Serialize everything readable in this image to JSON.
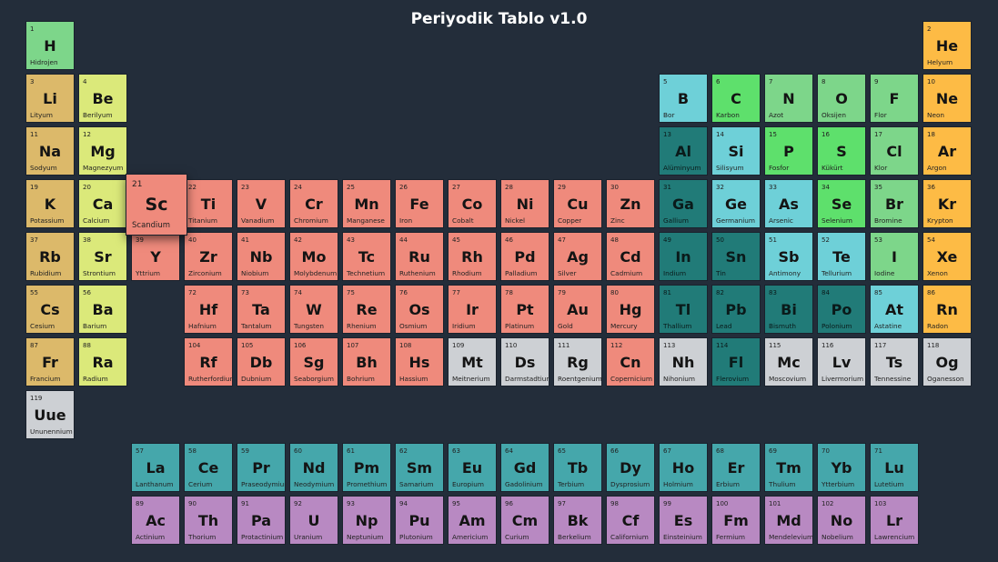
{
  "title": "Periyodik Tablo v1.0",
  "hovered_element": "Sc",
  "colors": {
    "hydrogen": "#7dd68a",
    "alkali": "#dcb96a",
    "alkaline": "#dbe97a",
    "transition": "#ef8a7c",
    "poor_metal": "#217b78",
    "metalloid": "#6ed0d8",
    "nonmetal": "#5ee06c",
    "halogen": "#7dd68a",
    "noble": "#fdbb45",
    "unknown": "#cdd0d4",
    "lanthanide": "#45a7ab",
    "actinide": "#b889c2"
  },
  "elements": [
    {
      "n": "1",
      "s": "H",
      "name": "Hidrojen",
      "c": "hydrogen"
    },
    {
      "n": "2",
      "s": "He",
      "name": "Helyum",
      "c": "noble"
    },
    {
      "n": "3",
      "s": "Li",
      "name": "Lityum",
      "c": "alkali"
    },
    {
      "n": "4",
      "s": "Be",
      "name": "Berilyum",
      "c": "alkaline"
    },
    {
      "n": "5",
      "s": "B",
      "name": "Bor",
      "c": "metalloid"
    },
    {
      "n": "6",
      "s": "C",
      "name": "Karbon",
      "c": "nonmetal"
    },
    {
      "n": "7",
      "s": "N",
      "name": "Azot",
      "c": "halogen"
    },
    {
      "n": "8",
      "s": "O",
      "name": "Oksijen",
      "c": "halogen"
    },
    {
      "n": "9",
      "s": "F",
      "name": "Flor",
      "c": "halogen"
    },
    {
      "n": "10",
      "s": "Ne",
      "name": "Neon",
      "c": "noble"
    },
    {
      "n": "11",
      "s": "Na",
      "name": "Sodyum",
      "c": "alkali"
    },
    {
      "n": "12",
      "s": "Mg",
      "name": "Magnezyum",
      "c": "alkaline"
    },
    {
      "n": "13",
      "s": "Al",
      "name": "Alüminyum",
      "c": "poor_metal"
    },
    {
      "n": "14",
      "s": "Si",
      "name": "Silisyum",
      "c": "metalloid"
    },
    {
      "n": "15",
      "s": "P",
      "name": "Fosfor",
      "c": "nonmetal"
    },
    {
      "n": "16",
      "s": "S",
      "name": "Kükürt",
      "c": "nonmetal"
    },
    {
      "n": "17",
      "s": "Cl",
      "name": "Klor",
      "c": "halogen"
    },
    {
      "n": "18",
      "s": "Ar",
      "name": "Argon",
      "c": "noble"
    },
    {
      "n": "19",
      "s": "K",
      "name": "Potassium",
      "c": "alkali"
    },
    {
      "n": "20",
      "s": "Ca",
      "name": "Calcium",
      "c": "alkaline"
    },
    {
      "n": "21",
      "s": "Sc",
      "name": "Scandium",
      "c": "transition"
    },
    {
      "n": "22",
      "s": "Ti",
      "name": "Titanium",
      "c": "transition"
    },
    {
      "n": "23",
      "s": "V",
      "name": "Vanadium",
      "c": "transition"
    },
    {
      "n": "24",
      "s": "Cr",
      "name": "Chromium",
      "c": "transition"
    },
    {
      "n": "25",
      "s": "Mn",
      "name": "Manganese",
      "c": "transition"
    },
    {
      "n": "26",
      "s": "Fe",
      "name": "Iron",
      "c": "transition"
    },
    {
      "n": "27",
      "s": "Co",
      "name": "Cobalt",
      "c": "transition"
    },
    {
      "n": "28",
      "s": "Ni",
      "name": "Nickel",
      "c": "transition"
    },
    {
      "n": "29",
      "s": "Cu",
      "name": "Copper",
      "c": "transition"
    },
    {
      "n": "30",
      "s": "Zn",
      "name": "Zinc",
      "c": "transition"
    },
    {
      "n": "31",
      "s": "Ga",
      "name": "Gallium",
      "c": "poor_metal"
    },
    {
      "n": "32",
      "s": "Ge",
      "name": "Germanium",
      "c": "metalloid"
    },
    {
      "n": "33",
      "s": "As",
      "name": "Arsenic",
      "c": "metalloid"
    },
    {
      "n": "34",
      "s": "Se",
      "name": "Selenium",
      "c": "nonmetal"
    },
    {
      "n": "35",
      "s": "Br",
      "name": "Bromine",
      "c": "halogen"
    },
    {
      "n": "36",
      "s": "Kr",
      "name": "Krypton",
      "c": "noble"
    },
    {
      "n": "37",
      "s": "Rb",
      "name": "Rubidium",
      "c": "alkali"
    },
    {
      "n": "38",
      "s": "Sr",
      "name": "Strontium",
      "c": "alkaline"
    },
    {
      "n": "39",
      "s": "Y",
      "name": "Yttrium",
      "c": "transition"
    },
    {
      "n": "40",
      "s": "Zr",
      "name": "Zirconium",
      "c": "transition"
    },
    {
      "n": "41",
      "s": "Nb",
      "name": "Niobium",
      "c": "transition"
    },
    {
      "n": "42",
      "s": "Mo",
      "name": "Molybdenum",
      "c": "transition"
    },
    {
      "n": "43",
      "s": "Tc",
      "name": "Technetium",
      "c": "transition"
    },
    {
      "n": "44",
      "s": "Ru",
      "name": "Ruthenium",
      "c": "transition"
    },
    {
      "n": "45",
      "s": "Rh",
      "name": "Rhodium",
      "c": "transition"
    },
    {
      "n": "46",
      "s": "Pd",
      "name": "Palladium",
      "c": "transition"
    },
    {
      "n": "47",
      "s": "Ag",
      "name": "Silver",
      "c": "transition"
    },
    {
      "n": "48",
      "s": "Cd",
      "name": "Cadmium",
      "c": "transition"
    },
    {
      "n": "49",
      "s": "In",
      "name": "Indium",
      "c": "poor_metal"
    },
    {
      "n": "50",
      "s": "Sn",
      "name": "Tin",
      "c": "poor_metal"
    },
    {
      "n": "51",
      "s": "Sb",
      "name": "Antimony",
      "c": "metalloid"
    },
    {
      "n": "52",
      "s": "Te",
      "name": "Tellurium",
      "c": "metalloid"
    },
    {
      "n": "53",
      "s": "I",
      "name": "Iodine",
      "c": "halogen"
    },
    {
      "n": "54",
      "s": "Xe",
      "name": "Xenon",
      "c": "noble"
    },
    {
      "n": "55",
      "s": "Cs",
      "name": "Cesium",
      "c": "alkali"
    },
    {
      "n": "56",
      "s": "Ba",
      "name": "Barium",
      "c": "alkaline"
    },
    {
      "n": "72",
      "s": "Hf",
      "name": "Hafnium",
      "c": "transition"
    },
    {
      "n": "73",
      "s": "Ta",
      "name": "Tantalum",
      "c": "transition"
    },
    {
      "n": "74",
      "s": "W",
      "name": "Tungsten",
      "c": "transition"
    },
    {
      "n": "75",
      "s": "Re",
      "name": "Rhenium",
      "c": "transition"
    },
    {
      "n": "76",
      "s": "Os",
      "name": "Osmium",
      "c": "transition"
    },
    {
      "n": "77",
      "s": "Ir",
      "name": "Iridium",
      "c": "transition"
    },
    {
      "n": "78",
      "s": "Pt",
      "name": "Platinum",
      "c": "transition"
    },
    {
      "n": "79",
      "s": "Au",
      "name": "Gold",
      "c": "transition"
    },
    {
      "n": "80",
      "s": "Hg",
      "name": "Mercury",
      "c": "transition"
    },
    {
      "n": "81",
      "s": "Tl",
      "name": "Thallium",
      "c": "poor_metal"
    },
    {
      "n": "82",
      "s": "Pb",
      "name": "Lead",
      "c": "poor_metal"
    },
    {
      "n": "83",
      "s": "Bi",
      "name": "Bismuth",
      "c": "poor_metal"
    },
    {
      "n": "84",
      "s": "Po",
      "name": "Polonium",
      "c": "poor_metal"
    },
    {
      "n": "85",
      "s": "At",
      "name": "Astatine",
      "c": "metalloid"
    },
    {
      "n": "86",
      "s": "Rn",
      "name": "Radon",
      "c": "noble"
    },
    {
      "n": "87",
      "s": "Fr",
      "name": "Francium",
      "c": "alkali"
    },
    {
      "n": "88",
      "s": "Ra",
      "name": "Radium",
      "c": "alkaline"
    },
    {
      "n": "104",
      "s": "Rf",
      "name": "Rutherfordium",
      "c": "transition"
    },
    {
      "n": "105",
      "s": "Db",
      "name": "Dubnium",
      "c": "transition"
    },
    {
      "n": "106",
      "s": "Sg",
      "name": "Seaborgium",
      "c": "transition"
    },
    {
      "n": "107",
      "s": "Bh",
      "name": "Bohrium",
      "c": "transition"
    },
    {
      "n": "108",
      "s": "Hs",
      "name": "Hassium",
      "c": "transition"
    },
    {
      "n": "109",
      "s": "Mt",
      "name": "Meitnerium",
      "c": "unknown"
    },
    {
      "n": "110",
      "s": "Ds",
      "name": "Darmstadtium",
      "c": "unknown"
    },
    {
      "n": "111",
      "s": "Rg",
      "name": "Roentgenium",
      "c": "unknown"
    },
    {
      "n": "112",
      "s": "Cn",
      "name": "Copernicium",
      "c": "transition"
    },
    {
      "n": "113",
      "s": "Nh",
      "name": "Nihonium",
      "c": "unknown"
    },
    {
      "n": "114",
      "s": "Fl",
      "name": "Flerovium",
      "c": "poor_metal"
    },
    {
      "n": "115",
      "s": "Mc",
      "name": "Moscovium",
      "c": "unknown"
    },
    {
      "n": "116",
      "s": "Lv",
      "name": "Livermorium",
      "c": "unknown"
    },
    {
      "n": "117",
      "s": "Ts",
      "name": "Tennessine",
      "c": "unknown"
    },
    {
      "n": "118",
      "s": "Og",
      "name": "Oganesson",
      "c": "unknown"
    },
    {
      "n": "119",
      "s": "Uue",
      "name": "Ununennium",
      "c": "unknown"
    },
    {
      "n": "57",
      "s": "La",
      "name": "Lanthanum",
      "c": "lanthanide"
    },
    {
      "n": "58",
      "s": "Ce",
      "name": "Cerium",
      "c": "lanthanide"
    },
    {
      "n": "59",
      "s": "Pr",
      "name": "Praseodymium",
      "c": "lanthanide"
    },
    {
      "n": "60",
      "s": "Nd",
      "name": "Neodymium",
      "c": "lanthanide"
    },
    {
      "n": "61",
      "s": "Pm",
      "name": "Promethium",
      "c": "lanthanide"
    },
    {
      "n": "62",
      "s": "Sm",
      "name": "Samarium",
      "c": "lanthanide"
    },
    {
      "n": "63",
      "s": "Eu",
      "name": "Europium",
      "c": "lanthanide"
    },
    {
      "n": "64",
      "s": "Gd",
      "name": "Gadolinium",
      "c": "lanthanide"
    },
    {
      "n": "65",
      "s": "Tb",
      "name": "Terbium",
      "c": "lanthanide"
    },
    {
      "n": "66",
      "s": "Dy",
      "name": "Dysprosium",
      "c": "lanthanide"
    },
    {
      "n": "67",
      "s": "Ho",
      "name": "Holmium",
      "c": "lanthanide"
    },
    {
      "n": "68",
      "s": "Er",
      "name": "Erbium",
      "c": "lanthanide"
    },
    {
      "n": "69",
      "s": "Tm",
      "name": "Thulium",
      "c": "lanthanide"
    },
    {
      "n": "70",
      "s": "Yb",
      "name": "Ytterbium",
      "c": "lanthanide"
    },
    {
      "n": "71",
      "s": "Lu",
      "name": "Lutetium",
      "c": "lanthanide"
    },
    {
      "n": "89",
      "s": "Ac",
      "name": "Actinium",
      "c": "actinide"
    },
    {
      "n": "90",
      "s": "Th",
      "name": "Thorium",
      "c": "actinide"
    },
    {
      "n": "91",
      "s": "Pa",
      "name": "Protactinium",
      "c": "actinide"
    },
    {
      "n": "92",
      "s": "U",
      "name": "Uranium",
      "c": "actinide"
    },
    {
      "n": "93",
      "s": "Np",
      "name": "Neptunium",
      "c": "actinide"
    },
    {
      "n": "94",
      "s": "Pu",
      "name": "Plutonium",
      "c": "actinide"
    },
    {
      "n": "95",
      "s": "Am",
      "name": "Americium",
      "c": "actinide"
    },
    {
      "n": "96",
      "s": "Cm",
      "name": "Curium",
      "c": "actinide"
    },
    {
      "n": "97",
      "s": "Bk",
      "name": "Berkelium",
      "c": "actinide"
    },
    {
      "n": "98",
      "s": "Cf",
      "name": "Californium",
      "c": "actinide"
    },
    {
      "n": "99",
      "s": "Es",
      "name": "Einsteinium",
      "c": "actinide"
    },
    {
      "n": "100",
      "s": "Fm",
      "name": "Fermium",
      "c": "actinide"
    },
    {
      "n": "101",
      "s": "Md",
      "name": "Mendelevium",
      "c": "actinide"
    },
    {
      "n": "102",
      "s": "No",
      "name": "Nobelium",
      "c": "actinide"
    },
    {
      "n": "103",
      "s": "Lr",
      "name": "Lawrencium",
      "c": "actinide"
    }
  ]
}
